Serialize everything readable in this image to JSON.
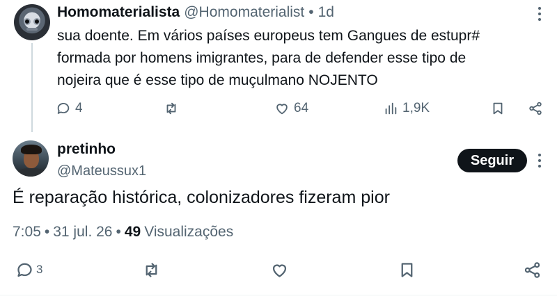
{
  "parent_tweet": {
    "author_name": "Homomaterialista",
    "author_handle": "@Homomaterialist",
    "dot": "•",
    "time": "1d",
    "text": "sua doente.  Em vários países europeus tem Gangues de estupr#\nformada por homens imigrantes, para de defender esse tipo de\nnojeira que é esse tipo de muçulmano NOJENTO",
    "replies": "4",
    "likes": "64",
    "views": "1,9K",
    "icons": [
      "reply-icon",
      "retweet-icon",
      "like-icon",
      "views-icon",
      "bookmark-icon",
      "share-icon",
      "more-icon"
    ]
  },
  "main_tweet": {
    "author_name": "pretinho",
    "author_handle": "@Mateussux1",
    "follow_label": "Seguir",
    "text": "É reparação histórica, colonizadores fizeram pior",
    "time": "7:05",
    "date": "31 jul. 26",
    "dot": "•",
    "views_count": "49",
    "views_label": "Visualizações",
    "replies": "3",
    "icons": [
      "reply-icon",
      "retweet-icon",
      "like-icon",
      "bookmark-icon",
      "share-icon",
      "more-icon"
    ]
  },
  "colors": {
    "text_primary": "#0f1419",
    "text_secondary": "#536471",
    "thread_line": "#cfd9de",
    "button_bg": "#0f1419",
    "button_text": "#ffffff"
  }
}
